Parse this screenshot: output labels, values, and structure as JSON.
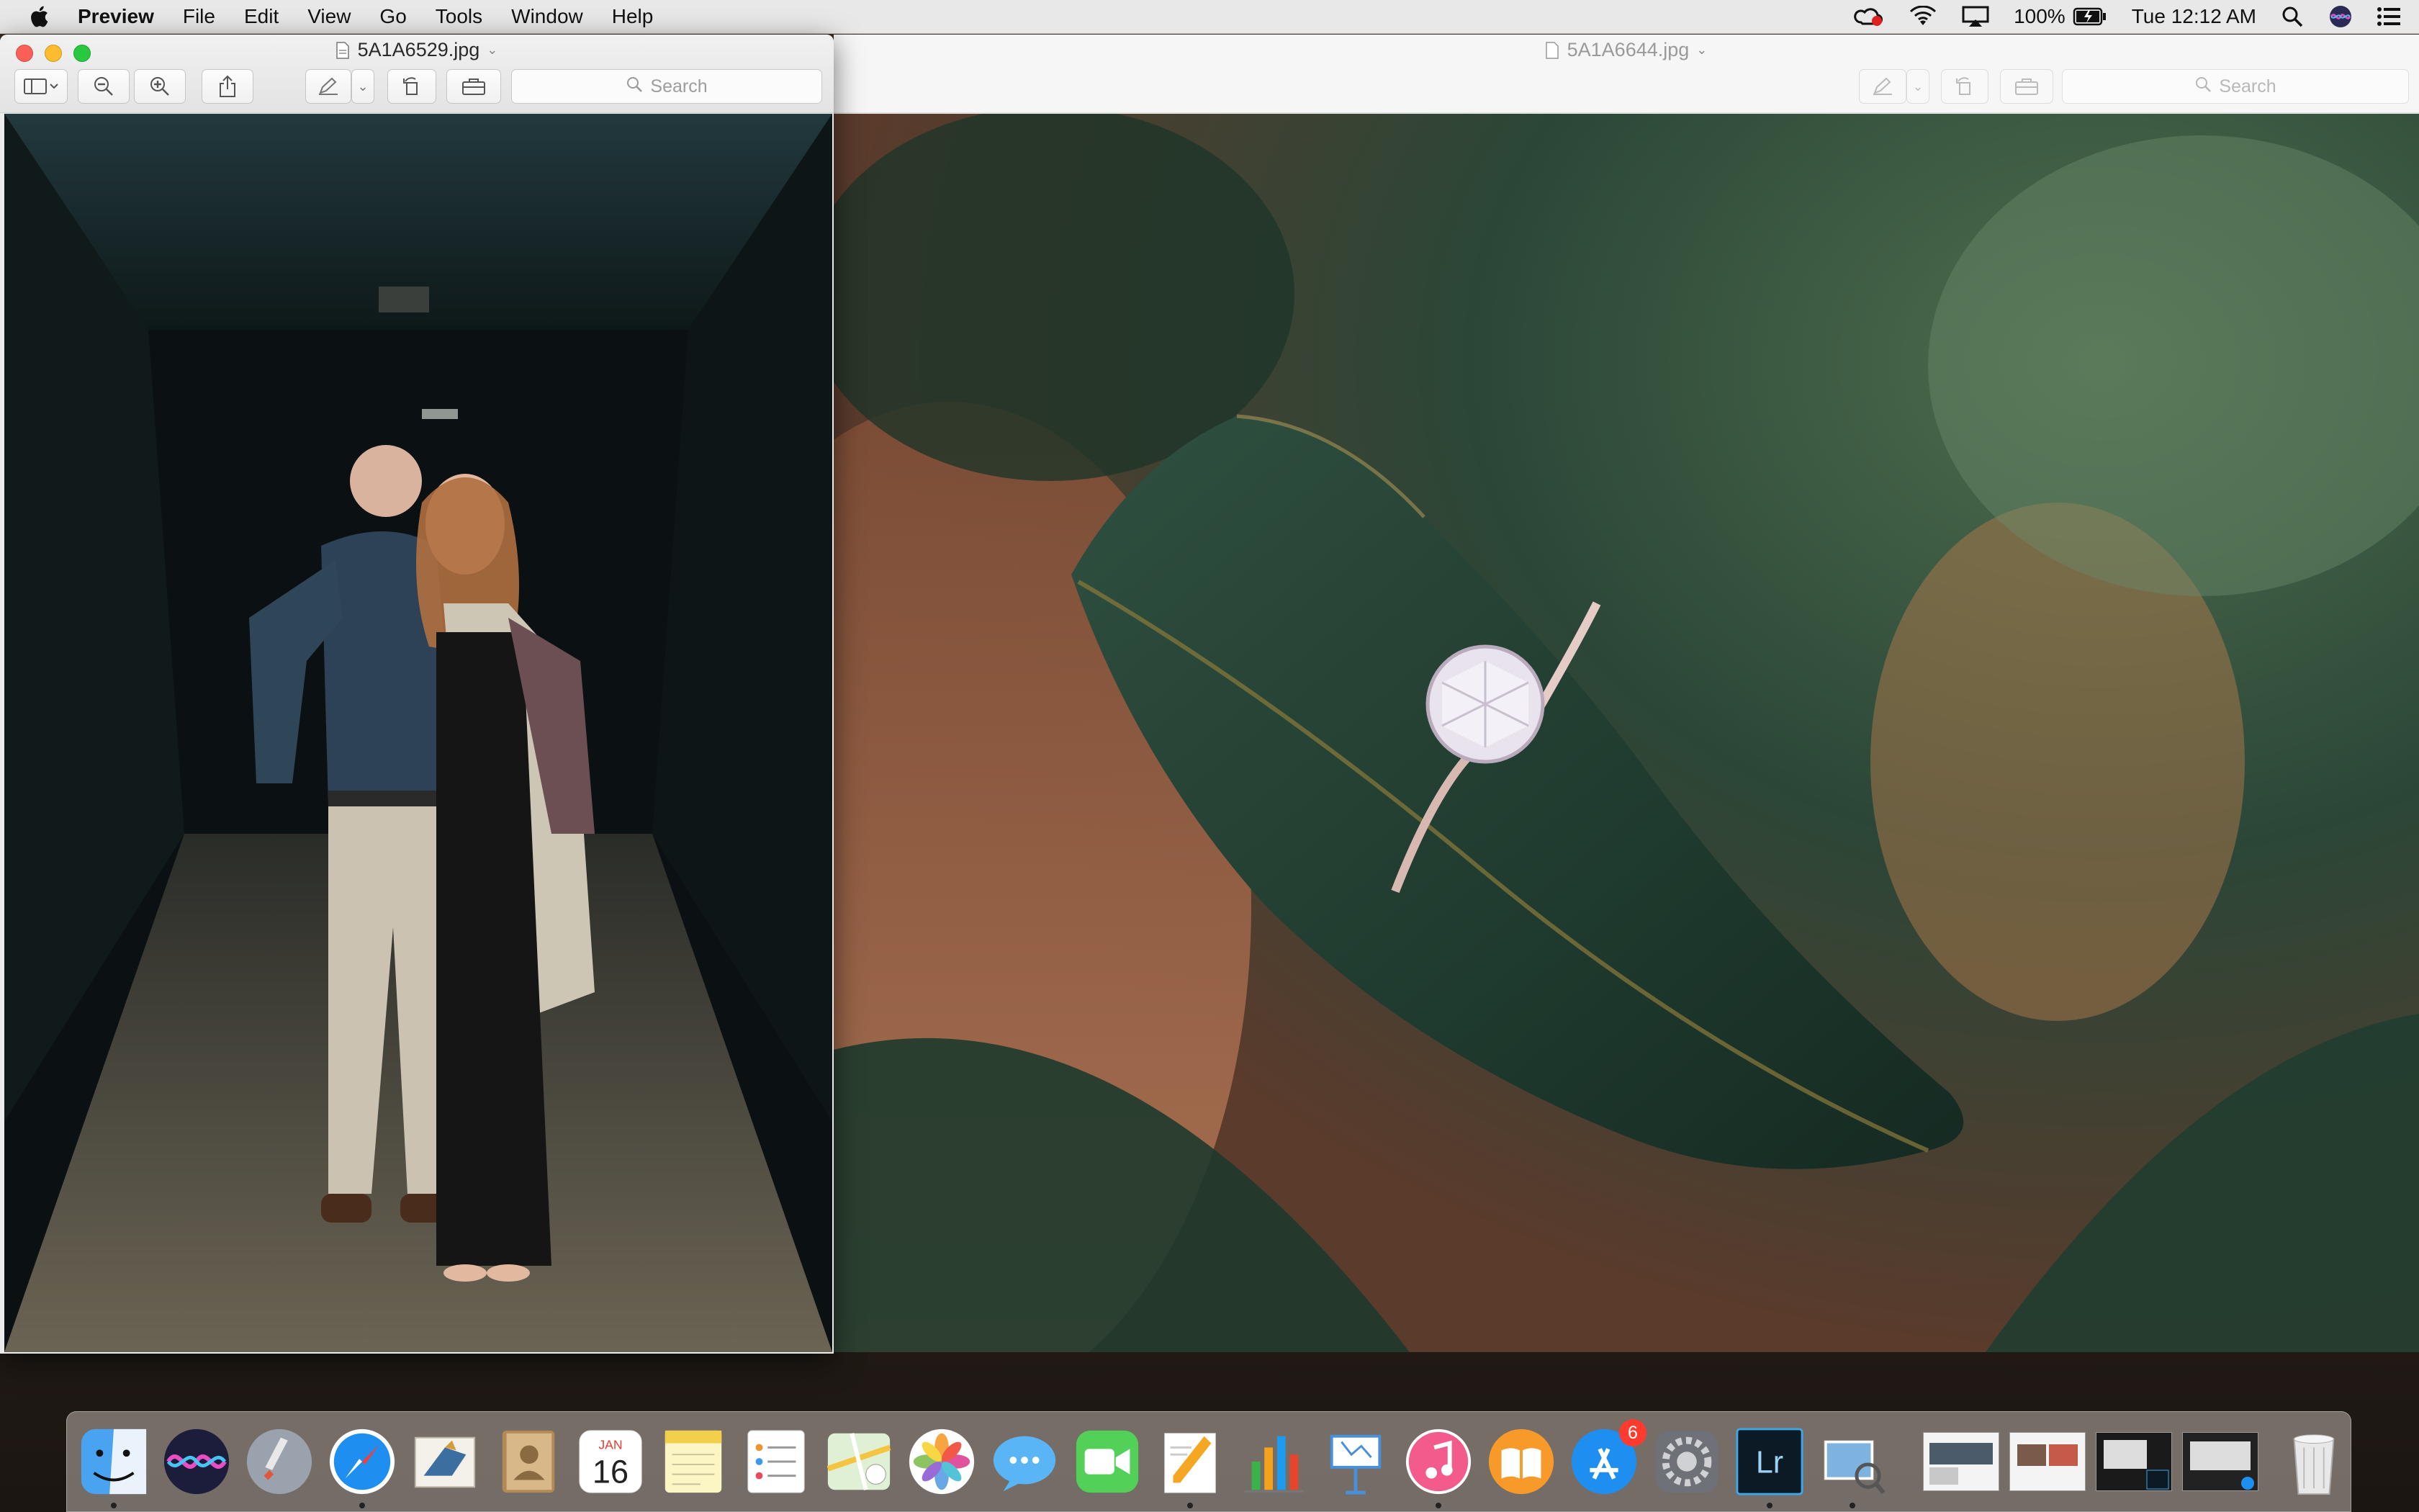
{
  "menubar": {
    "app_name": "Preview",
    "items": [
      "File",
      "Edit",
      "View",
      "Go",
      "Tools",
      "Window",
      "Help"
    ],
    "status": {
      "battery": "100%",
      "clock": "Tue 12:12 AM"
    }
  },
  "left_window": {
    "title": "5A1A6529.jpg",
    "search_placeholder": "Search",
    "photo_description_icon": "couple-photo"
  },
  "right_window": {
    "title": "5A1A6644.jpg",
    "search_placeholder": "Search",
    "photo_description_icon": "ring-photo"
  },
  "dock": {
    "calendar_month": "JAN",
    "calendar_day": "16",
    "app_store_badge": "6",
    "lightroom_label": "Lr",
    "apps": [
      "finder-icon",
      "siri-icon",
      "launchpad-icon",
      "safari-icon",
      "mail-icon",
      "contacts-icon",
      "calendar-icon",
      "notes-icon",
      "reminders-icon",
      "maps-icon",
      "photos-icon",
      "messages-icon",
      "facetime-icon",
      "pages-icon",
      "numbers-icon",
      "keynote-icon",
      "itunes-icon",
      "ibooks-icon",
      "app-store-icon",
      "system-preferences-icon",
      "lightroom-icon",
      "preview-icon"
    ]
  },
  "colors": {
    "close": "#fc5f57",
    "minimize": "#fdbc2e",
    "maximize": "#28c840",
    "badge": "#ff3b30"
  }
}
